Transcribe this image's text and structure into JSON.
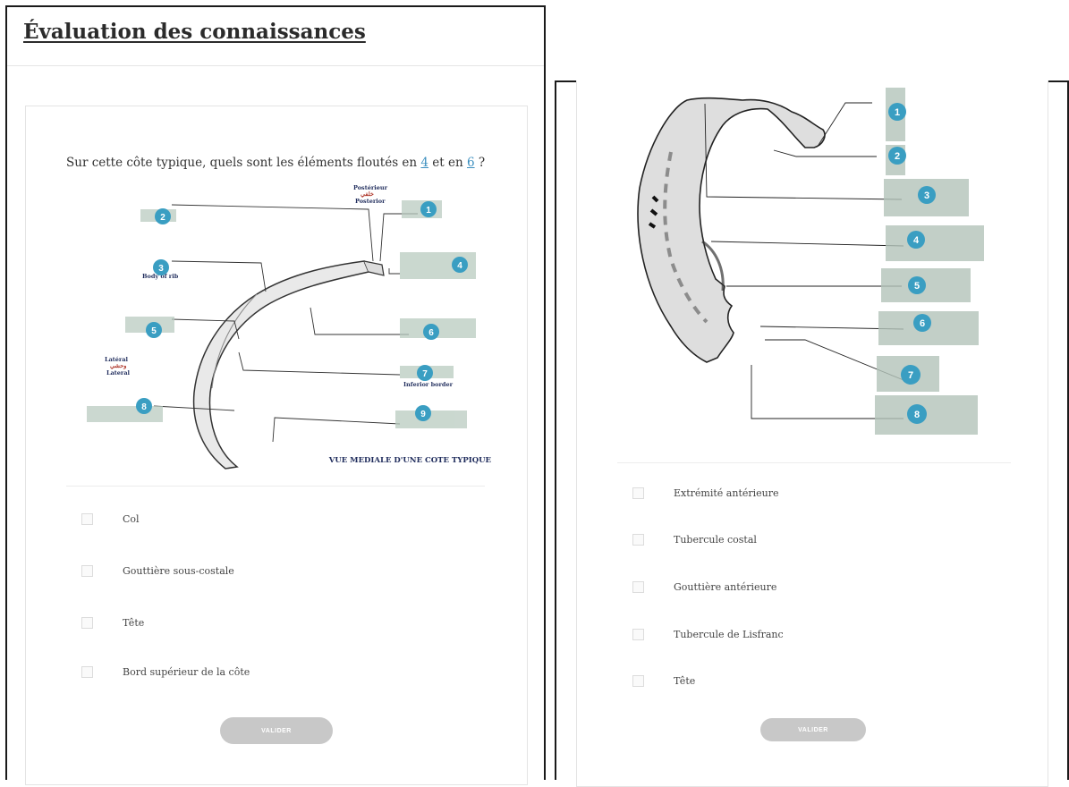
{
  "left": {
    "title": "Évaluation des connaissances",
    "question_prefix": "Sur cette côte typique, quels sont les éléments floutés en ",
    "ref_a": "4",
    "question_middle": " et en ",
    "ref_b": "6",
    "question_suffix": " ?",
    "diagram": {
      "caption": "VUE MEDIALE D'UNE COTE TYPIQUE",
      "top_label_fr": "Postérieur",
      "top_label_ar": "خلفي",
      "top_label_en": "Posterior",
      "side_label_fr": "Latéral",
      "side_label_ar": "وحشي",
      "side_label_en": "Lateral",
      "label_3_en": "Body of rib",
      "label_7_en": "Inferior border",
      "markers": [
        "1",
        "2",
        "3",
        "4",
        "5",
        "6",
        "7",
        "8",
        "9"
      ]
    },
    "options": [
      "Col",
      "Gouttière sous-costale",
      "Tête",
      "Bord supérieur de la côte"
    ],
    "submit_label": "VALIDER"
  },
  "right": {
    "diagram": {
      "markers": [
        "1",
        "2",
        "3",
        "4",
        "5",
        "6",
        "7",
        "8"
      ]
    },
    "options": [
      "Extrémité antérieure",
      "Tubercule costal",
      "Gouttière antérieure",
      "Tubercule de Lisfranc",
      "Tête"
    ],
    "submit_label": "VALIDER"
  },
  "colors": {
    "marker": "#3a9ec2",
    "link": "#3c8fbf",
    "button": "#c8c8c8",
    "blur_label": "#8fb3a0"
  }
}
